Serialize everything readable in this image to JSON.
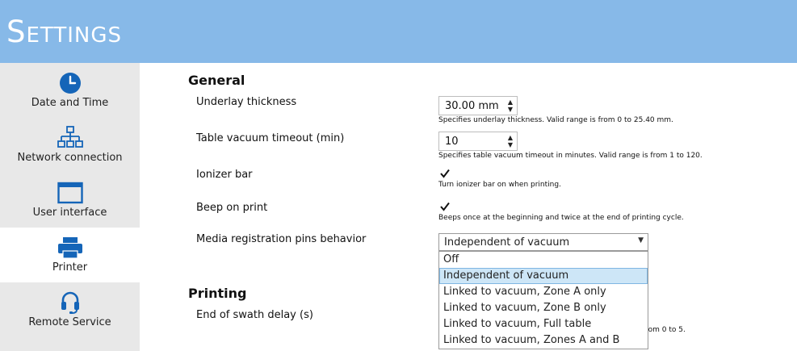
{
  "header": {
    "title": "Settings"
  },
  "sidebar": {
    "items": [
      {
        "label": "Date and Time",
        "icon": "clock-icon"
      },
      {
        "label": "Network connection",
        "icon": "network-icon"
      },
      {
        "label": "User interface",
        "icon": "window-icon"
      },
      {
        "label": "Printer",
        "icon": "printer-icon",
        "active": true
      },
      {
        "label": "Remote Service",
        "icon": "headset-icon"
      }
    ],
    "icon_color": "#1565b8"
  },
  "general": {
    "title": "General",
    "underlay": {
      "label": "Underlay thickness",
      "value": "30.00 mm",
      "hint": "Specifies underlay thickness. Valid range is from 0 to 25.40 mm."
    },
    "vacuum_timeout": {
      "label": "Table vacuum timeout (min)",
      "value": "10",
      "hint": "Specifies table vacuum timeout in minutes. Valid range is from 1 to 120."
    },
    "ionizer": {
      "label": "Ionizer bar",
      "checked": true,
      "hint": "Turn ionizer bar on when printing."
    },
    "beep": {
      "label": "Beep on print",
      "checked": true,
      "hint": "Beeps once at the beginning and twice at the end of printing cycle."
    },
    "pins": {
      "label": "Media registration pins behavior",
      "selected": "Independent of vacuum",
      "options": [
        "Off",
        "Independent of vacuum",
        "Linked to vacuum, Zone A only",
        "Linked to vacuum, Zone B only",
        "Linked to vacuum, Full table",
        "Linked to vacuum, Zones A and B"
      ]
    }
  },
  "printing": {
    "title": "Printing",
    "swath_delay": {
      "label": "End of swath delay (s)",
      "hint_partial": "from 0 to 5."
    }
  }
}
